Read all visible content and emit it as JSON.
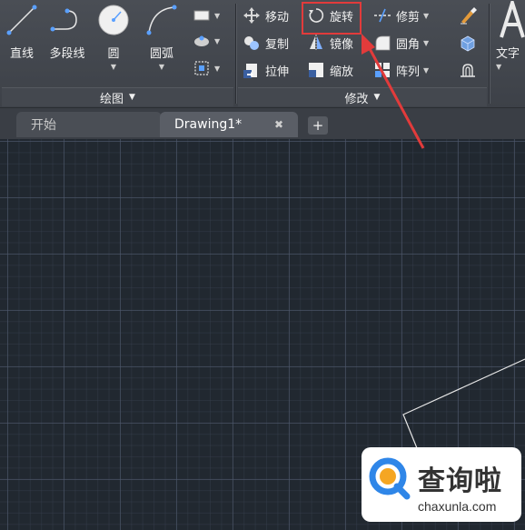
{
  "ribbon": {
    "draw_panel": {
      "title": "绘图",
      "line_label": "直线",
      "polyline_label": "多段线",
      "circle_label": "圆",
      "arc_label": "圆弧"
    },
    "modify_panel": {
      "title": "修改",
      "move_label": "移动",
      "rotate_label": "旋转",
      "trim_label": "修剪",
      "copy_label": "复制",
      "mirror_label": "镜像",
      "fillet_label": "圆角",
      "stretch_label": "拉伸",
      "scale_label": "缩放",
      "array_label": "阵列"
    },
    "annotation_panel": {
      "text_label": "文字"
    },
    "highlight_color": "#e23b3b"
  },
  "tabs": [
    {
      "label": "开始",
      "active": false
    },
    {
      "label": "Drawing1*",
      "active": true
    }
  ],
  "tab_close_glyph": "✖",
  "tab_add_glyph": "+",
  "watermark": {
    "title": "查询啦",
    "subtitle": "chaxunla.com"
  }
}
